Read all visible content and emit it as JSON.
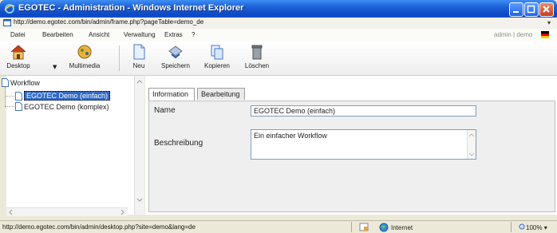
{
  "window": {
    "title": "EGOTEC - Administration - Windows Internet Explorer"
  },
  "address": {
    "url": "http://demo.egotec.com/bin/admin/frame.php?pageTable=demo_de"
  },
  "menu": {
    "items": [
      "Datei",
      "Bearbeiten",
      "Ansicht",
      "Verwaltung",
      "Extras",
      "?"
    ],
    "user": "admin | demo"
  },
  "toolbar": {
    "desktop": "Desktop",
    "multimedia": "Multimedia",
    "new": "Neu",
    "save": "Speichern",
    "copy": "Kopieren",
    "delete": "Löschen"
  },
  "tree": {
    "root": "Workflow",
    "items": [
      "EGOTEC Demo (einfach)",
      "EGOTEC Demo (komplex)"
    ],
    "selected_index": 0
  },
  "tabs": [
    "Information",
    "Bearbeitung"
  ],
  "form": {
    "name_label": "Name",
    "name_value": "EGOTEC Demo (einfach)",
    "desc_label": "Beschreibung",
    "desc_value": "Ein einfacher Workflow"
  },
  "status": {
    "url": "http://demo.egotec.com/bin/admin/desktop.php?site=demo&lang=de",
    "zone": "Internet",
    "zoom": "100%"
  },
  "colors": {
    "title_bar": "#1d60d6",
    "selection": "#3169c6",
    "input_border": "#7f9db9"
  }
}
